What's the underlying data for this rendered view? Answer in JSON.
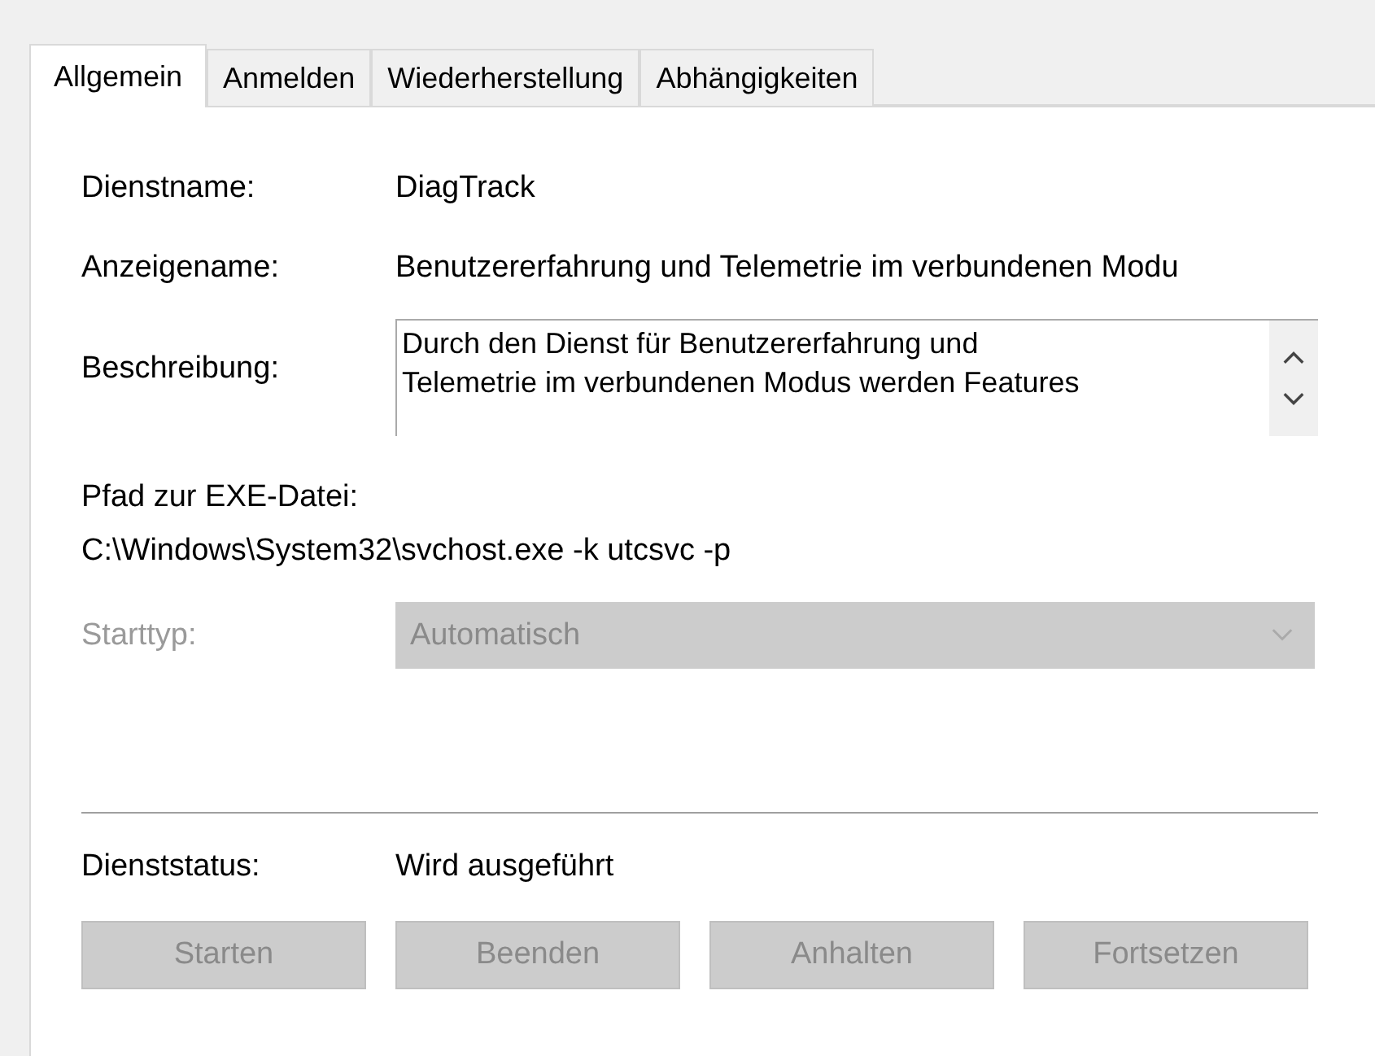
{
  "tabs": [
    {
      "label": "Allgemein",
      "selected": true
    },
    {
      "label": "Anmelden",
      "selected": false
    },
    {
      "label": "Wiederherstellung",
      "selected": false
    },
    {
      "label": "Abhängigkeiten",
      "selected": false
    }
  ],
  "service_name": {
    "label": "Dienstname:",
    "value": "DiagTrack"
  },
  "display_name": {
    "label": "Anzeigename:",
    "value": "Benutzererfahrung und Telemetrie im verbundenen Modu"
  },
  "description": {
    "label": "Beschreibung:",
    "lines": [
      "Durch den Dienst für Benutzererfahrung und",
      "Telemetrie im verbundenen Modus werden Features"
    ]
  },
  "exe_path": {
    "label": "Pfad zur EXE-Datei:",
    "value": "C:\\Windows\\System32\\svchost.exe -k utcsvc -p"
  },
  "startup_type": {
    "label": "Starttyp:",
    "value": "Automatisch",
    "disabled": true
  },
  "service_status": {
    "label": "Dienststatus:",
    "value": "Wird ausgeführt"
  },
  "buttons": [
    {
      "label": "Starten",
      "disabled": true
    },
    {
      "label": "Beenden",
      "disabled": true
    },
    {
      "label": "Anhalten",
      "disabled": true
    },
    {
      "label": "Fortsetzen",
      "disabled": true
    }
  ]
}
